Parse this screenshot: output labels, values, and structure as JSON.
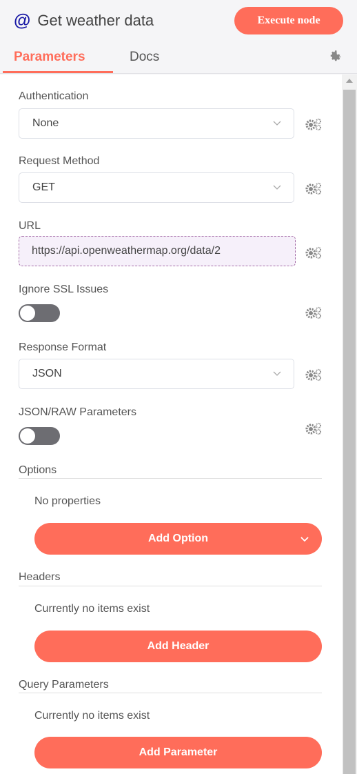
{
  "header": {
    "title": "Get weather data",
    "execute_label": "Execute node",
    "icon": "at-icon"
  },
  "tabs": [
    {
      "label": "Parameters",
      "active": true
    },
    {
      "label": "Docs",
      "active": false
    }
  ],
  "fields": {
    "authentication": {
      "label": "Authentication",
      "value": "None"
    },
    "request_method": {
      "label": "Request Method",
      "value": "GET"
    },
    "url": {
      "label": "URL",
      "value": "https://api.openweathermap.org/data/2"
    },
    "ignore_ssl": {
      "label": "Ignore SSL Issues",
      "on": false
    },
    "response_format": {
      "label": "Response Format",
      "value": "JSON"
    },
    "json_raw": {
      "label": "JSON/RAW Parameters",
      "on": false
    }
  },
  "sections": {
    "options": {
      "title": "Options",
      "empty_text": "No properties",
      "button": "Add Option"
    },
    "headers": {
      "title": "Headers",
      "empty_text": "Currently no items exist",
      "button": "Add Header"
    },
    "query": {
      "title": "Query Parameters",
      "empty_text": "Currently no items exist",
      "button": "Add Parameter"
    }
  },
  "colors": {
    "accent": "#ff6d5a",
    "icon_blue": "#1a1aa6",
    "toggle_off": "#6d6d72",
    "url_bg": "#f6f0fa"
  }
}
